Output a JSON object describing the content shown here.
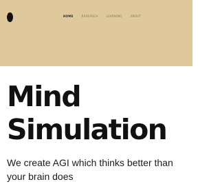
{
  "nav": {
    "items": [
      {
        "label": "HOME",
        "active": true
      },
      {
        "label": "RESEARCH",
        "active": false
      },
      {
        "label": "LEARNING",
        "active": false
      },
      {
        "label": "ABOUT",
        "active": false
      }
    ]
  },
  "hero": {
    "title_line1": "Mind",
    "title_line2": "Simulation",
    "subtitle": "We create AGI which thinks better than your brain does"
  },
  "colors": {
    "header_bg": "#dfc89c",
    "text": "#111111",
    "nav_active": "#2a2418",
    "nav_inactive": "#8a7551"
  }
}
